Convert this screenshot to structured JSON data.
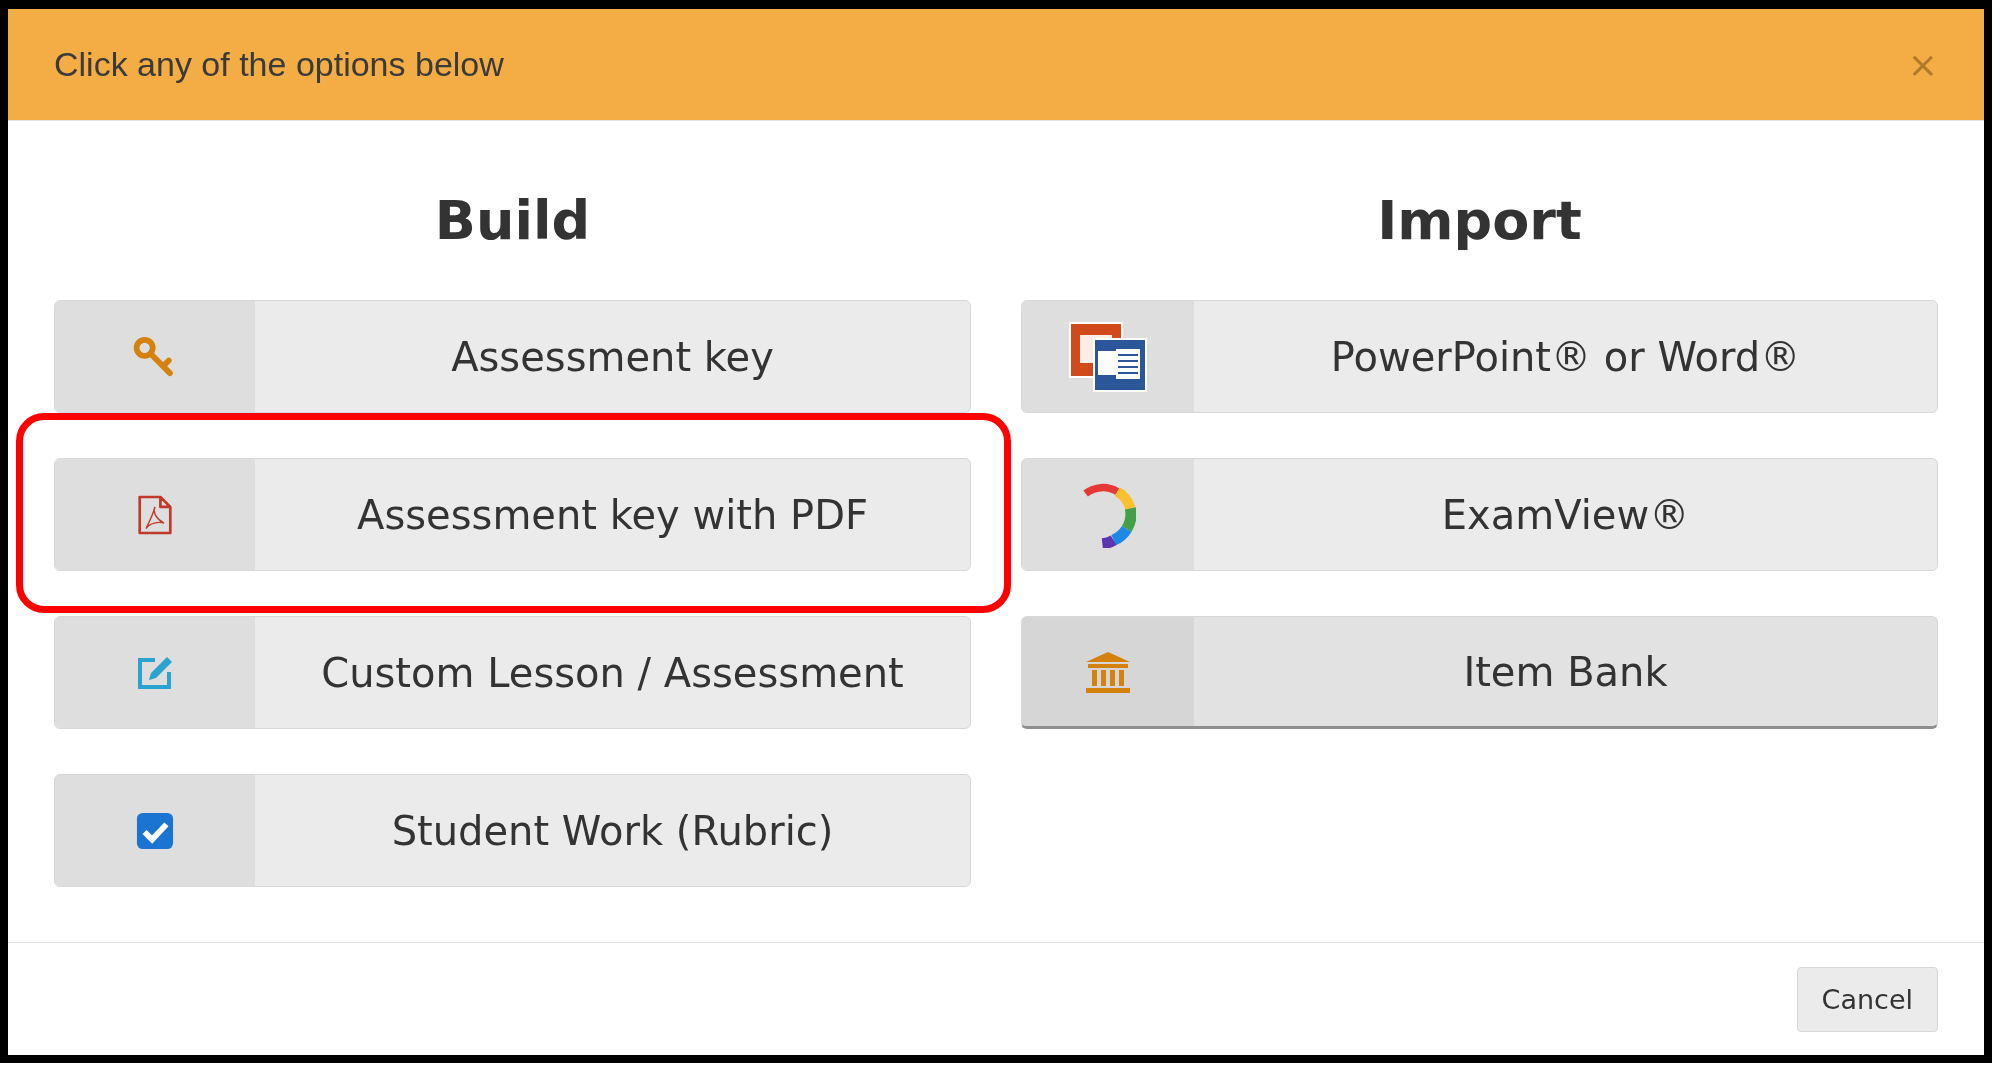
{
  "dialog": {
    "title": "Click any of the options below",
    "close": "×"
  },
  "columns": [
    {
      "heading": "Build",
      "options": [
        {
          "label": "Assessment key",
          "kind": "key",
          "hovered": false,
          "highlighted": false
        },
        {
          "label": "Assessment key with PDF",
          "kind": "pdf",
          "hovered": false,
          "highlighted": true
        },
        {
          "label": "Custom Lesson / Assessment",
          "kind": "edit",
          "hovered": false,
          "highlighted": false
        },
        {
          "label": "Student Work (Rubric)",
          "kind": "checkbox",
          "hovered": false,
          "highlighted": false
        }
      ]
    },
    {
      "heading": "Import",
      "options": [
        {
          "label": "PowerPoint® or Word®",
          "kind": "office",
          "hovered": false,
          "highlighted": false
        },
        {
          "label": "ExamView®",
          "kind": "examview",
          "hovered": false,
          "highlighted": false
        },
        {
          "label": "Item Bank",
          "kind": "bank",
          "hovered": true,
          "highlighted": false
        }
      ]
    }
  ],
  "footer": {
    "buttons": [
      "Cancel"
    ]
  }
}
